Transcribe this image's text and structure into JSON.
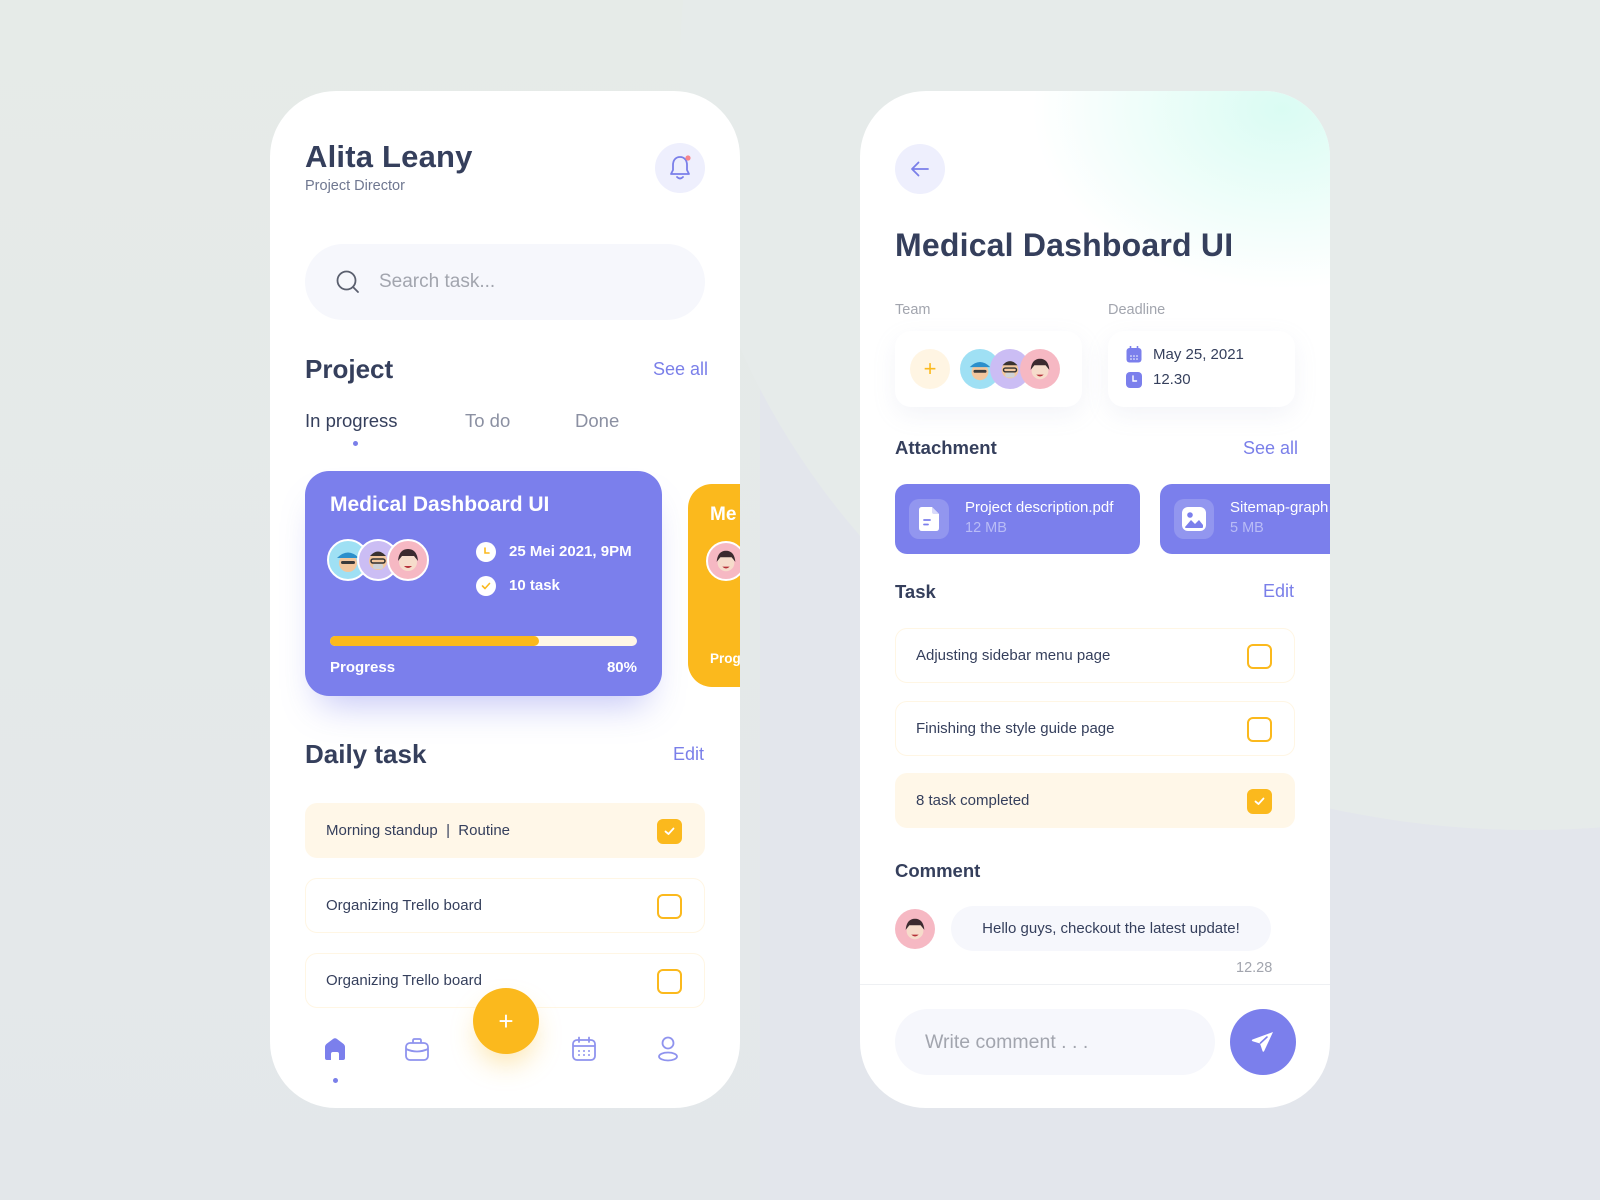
{
  "colors": {
    "primary": "#7b7fec",
    "accent": "#fbb91d",
    "text_dark": "#353f5c",
    "text_muted": "#a2a5ae",
    "link": "#7a7fe9"
  },
  "home": {
    "user_name": "Alita Leany",
    "user_role": "Project Director",
    "notification_icon": "bell-icon",
    "has_unread_notification": true,
    "search": {
      "placeholder": "Search task..."
    },
    "project_section": {
      "title": "Project",
      "see_all_label": "See all",
      "tabs": [
        {
          "label": "In progress",
          "active": true
        },
        {
          "label": "To do",
          "active": false
        },
        {
          "label": "Done",
          "active": false
        }
      ],
      "cards": [
        {
          "title": "Medical Dashboard UI",
          "due": "25 Mei 2021, 9PM",
          "task_count": "10 task",
          "progress_label": "Progress",
          "progress_text": "80%",
          "progress_fraction": 0.68,
          "color": "#7b7fec",
          "team_avatars": [
            "avatar-blue-hat",
            "avatar-glasses",
            "avatar-pink"
          ]
        },
        {
          "title": "Me",
          "progress_label": "Prog",
          "color": "#fbb91d",
          "team_avatars": [
            "avatar-pink"
          ]
        }
      ]
    },
    "daily_task_section": {
      "title": "Daily task",
      "edit_label": "Edit",
      "tasks": [
        {
          "label": "Morning standup  |  Routine",
          "checked": true
        },
        {
          "label": "Organizing Trello board",
          "checked": false
        },
        {
          "label": "Organizing Trello board",
          "checked": false
        }
      ]
    },
    "fab_label": "+",
    "bottom_nav": [
      {
        "name": "home",
        "icon": "home-icon",
        "active": true
      },
      {
        "name": "projects",
        "icon": "briefcase-icon",
        "active": false
      },
      {
        "name": "calendar",
        "icon": "calendar-icon",
        "active": false
      },
      {
        "name": "profile",
        "icon": "user-icon",
        "active": false
      }
    ]
  },
  "detail": {
    "back_icon": "arrow-left-icon",
    "title": "Medical Dashboard UI",
    "team_label": "Team",
    "add_member_label": "+",
    "deadline_label": "Deadline",
    "deadline_date": "May 25, 2021",
    "deadline_time": "12.30",
    "attachment_section": {
      "title": "Attachment",
      "see_all_label": "See all",
      "files": [
        {
          "name": "Project description.pdf",
          "size": "12 MB",
          "icon": "document-icon"
        },
        {
          "name": "Sitemap-graph",
          "size": "5 MB",
          "icon": "image-icon"
        }
      ]
    },
    "task_section": {
      "title": "Task",
      "edit_label": "Edit",
      "tasks": [
        {
          "label": "Adjusting sidebar menu page",
          "checked": false
        },
        {
          "label": "Finishing the style guide page",
          "checked": false
        },
        {
          "label": "8 task completed",
          "checked": true
        }
      ]
    },
    "comment_section": {
      "title": "Comment",
      "comments": [
        {
          "text": "Hello guys, checkout the latest update!",
          "time": "12.28",
          "avatar": "avatar-pink"
        }
      ],
      "input_placeholder": "Write comment . . .",
      "send_icon": "send-icon"
    }
  }
}
